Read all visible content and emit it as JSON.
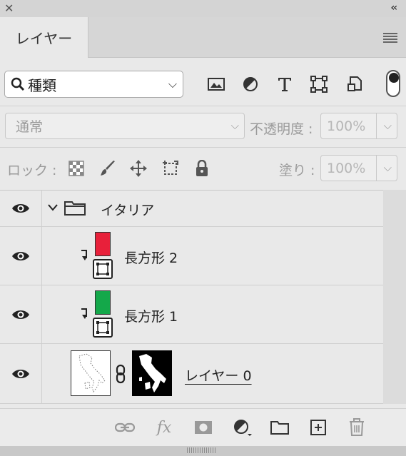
{
  "window": {
    "close_icon": "close-icon",
    "collapse_glyph": "‹‹"
  },
  "tab": {
    "label": "レイヤー"
  },
  "filter": {
    "kind_label": "種類",
    "icons": [
      "image-filter-icon",
      "adjustment-filter-icon",
      "type-filter-icon",
      "shape-filter-icon",
      "smart-object-filter-icon"
    ],
    "toggle_on": true
  },
  "blend": {
    "mode": "通常",
    "opacity_label": "不透明度 :",
    "opacity_value": "100%"
  },
  "lock": {
    "label": "ロック :",
    "fill_label": "塗り :",
    "fill_value": "100%"
  },
  "layers": [
    {
      "name": "イタリア",
      "type": "group",
      "expanded": true,
      "visible": true
    },
    {
      "name": "長方形 2",
      "type": "shape",
      "clipped": true,
      "color": "#e8203a",
      "visible": true
    },
    {
      "name": "長方形 1",
      "type": "shape",
      "clipped": true,
      "color": "#14a84a",
      "visible": true
    },
    {
      "name": "レイヤー 0",
      "type": "pixel-with-mask",
      "visible": true
    }
  ],
  "bottom_icons": [
    "link-layers-icon",
    "fx-icon",
    "add-mask-icon",
    "new-adjustment-icon",
    "new-group-icon",
    "new-layer-icon",
    "delete-icon"
  ],
  "fx_label": "fx"
}
